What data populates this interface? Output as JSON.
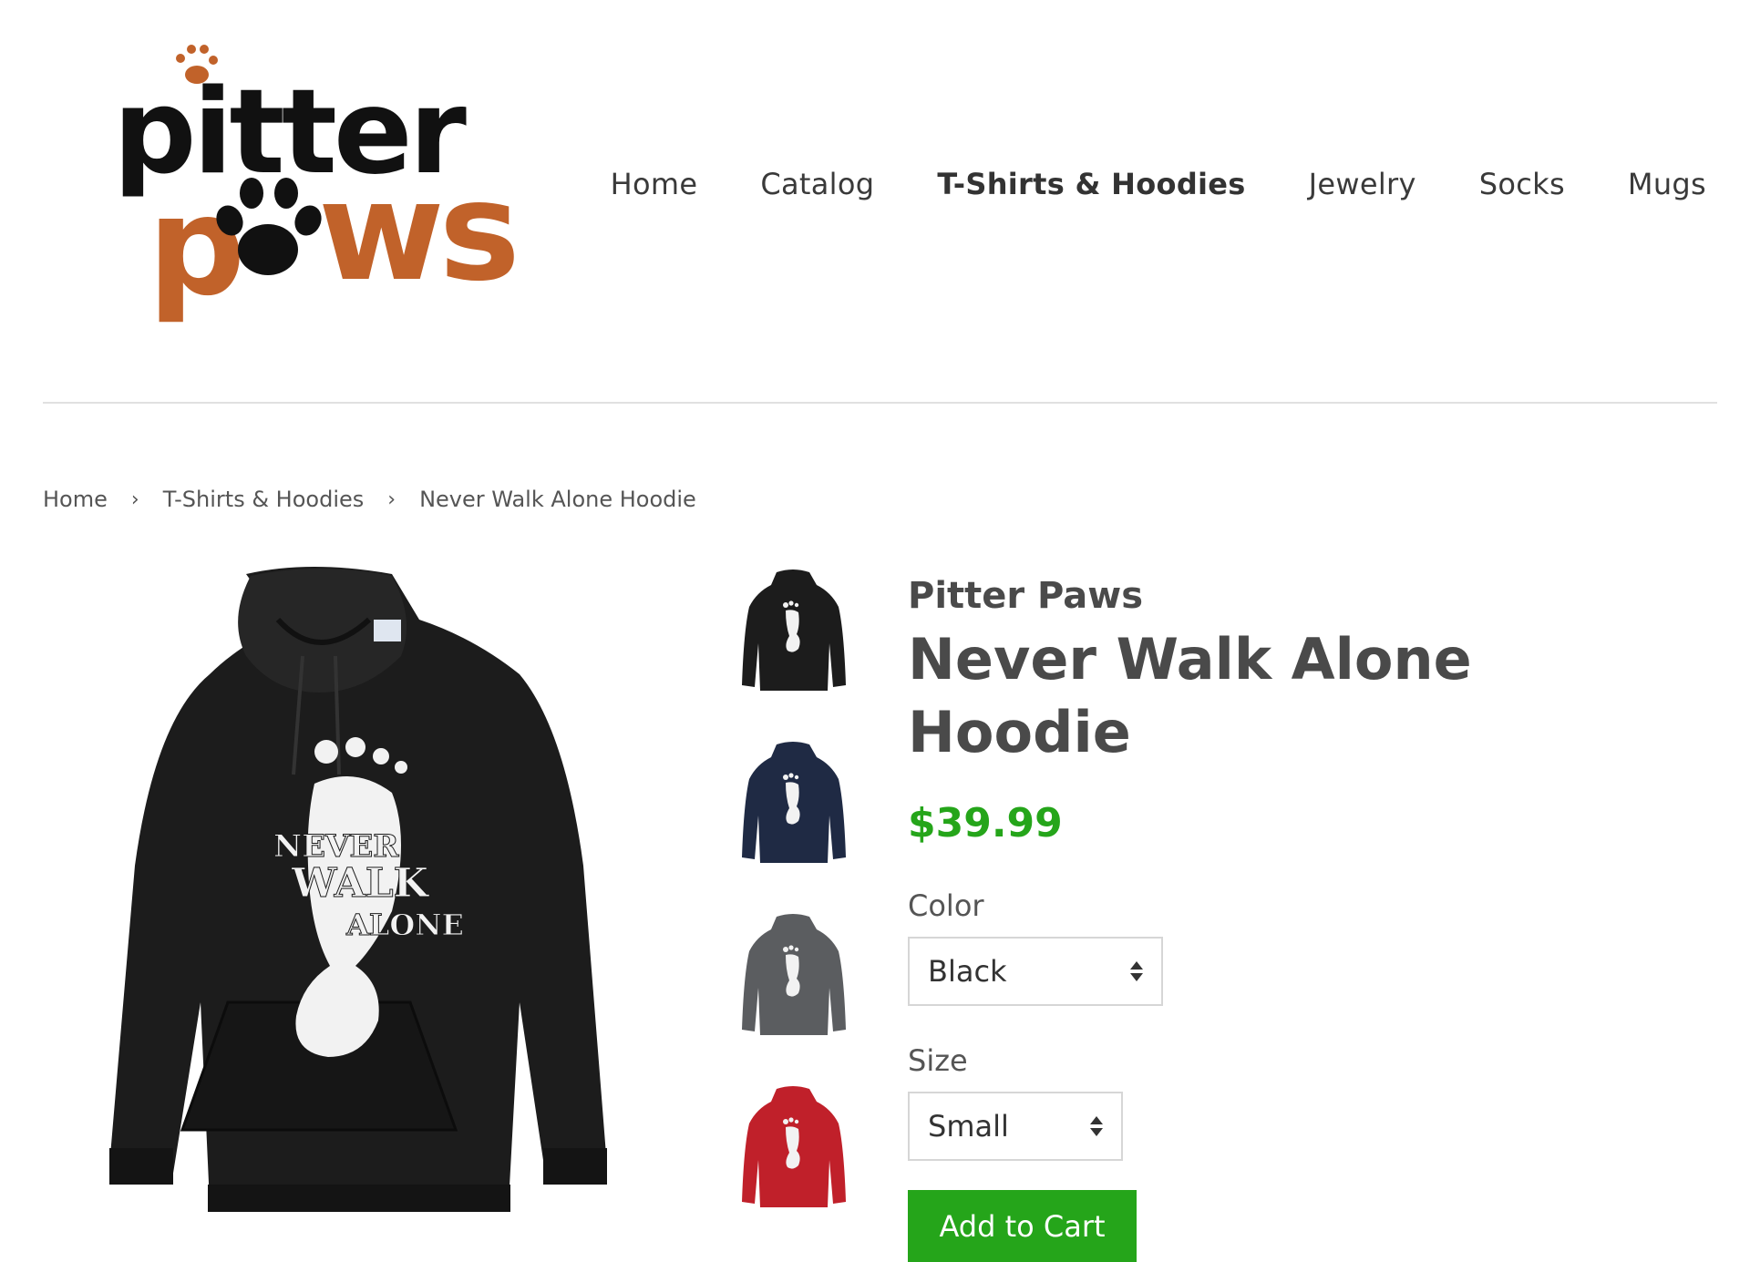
{
  "brand": {
    "logo_line1": "pitter",
    "logo_line2": "paws",
    "colors": {
      "black": "#111111",
      "orange": "#c1622a"
    }
  },
  "nav": {
    "items": [
      {
        "label": "Home",
        "active": false
      },
      {
        "label": "Catalog",
        "active": false
      },
      {
        "label": "T-Shirts & Hoodies",
        "active": true
      },
      {
        "label": "Jewelry",
        "active": false
      },
      {
        "label": "Socks",
        "active": false
      },
      {
        "label": "Mugs",
        "active": false
      }
    ]
  },
  "breadcrumb": {
    "items": [
      "Home",
      "T-Shirts & Hoodies",
      "Never Walk Alone Hoodie"
    ],
    "separator": "›"
  },
  "product": {
    "vendor": "Pitter Paws",
    "title": "Never Walk Alone Hoodie",
    "price": "$39.99",
    "price_color": "#25a51a",
    "print_text": [
      "NEVER",
      "WALK",
      "ALONE"
    ],
    "thumbnails": [
      {
        "color_hex": "#1c1c1c"
      },
      {
        "color_hex": "#1f2a44"
      },
      {
        "color_hex": "#5b5d60"
      },
      {
        "color_hex": "#c0202a"
      }
    ],
    "options": {
      "color_label": "Color",
      "color_value": "Black",
      "size_label": "Size",
      "size_value": "Small"
    },
    "add_to_cart_label": "Add to Cart"
  }
}
